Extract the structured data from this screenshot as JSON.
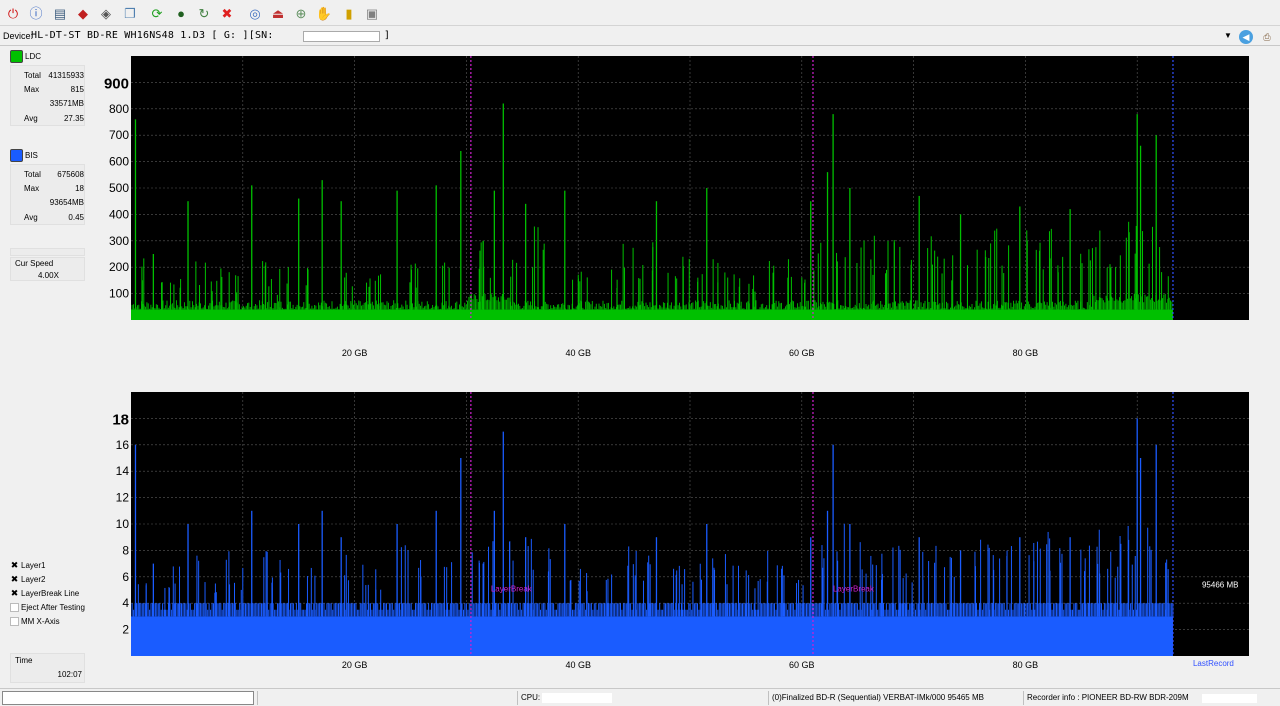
{
  "toolbar": {
    "icons": [
      "power-icon",
      "disc-info-icon",
      "drive-icon",
      "erase-icon",
      "burn-icon",
      "copy-icon",
      "refresh-icon",
      "start-test-icon",
      "rescan-icon",
      "stop-icon",
      "disc-icon",
      "eject-icon",
      "write-icon",
      "settings-icon",
      "chart-icon",
      "save-icon"
    ]
  },
  "device": {
    "label": "Device:",
    "name": "HL-DT-ST BD-RE  WH16NS48  1.D3 [ G: ][SN:",
    "sn_close": "]"
  },
  "sidebar": {
    "ldc": {
      "label": "LDC",
      "color": "#00c000",
      "total_label": "Total",
      "total": "41315933",
      "max_label": "Max",
      "max": "815",
      "max_pos": "33571MB",
      "avg_label": "Avg",
      "avg": "27.35"
    },
    "bis": {
      "label": "BIS",
      "color": "#1a5cff",
      "total_label": "Total",
      "total": "675608",
      "max_label": "Max",
      "max": "18",
      "max_pos": "93654MB",
      "avg_label": "Avg",
      "avg": "0.45"
    },
    "cur_speed_label": "Cur Speed",
    "cur_speed": "4.00X",
    "options": [
      {
        "label": "Layer1",
        "checked": true
      },
      {
        "label": "Layer2",
        "checked": true
      },
      {
        "label": "LayerBreak Line",
        "checked": true
      },
      {
        "label": "Eject After Testing",
        "checked": false
      },
      {
        "label": "MM X-Axis",
        "checked": false
      }
    ],
    "time_label": "Time",
    "time": "102:07"
  },
  "chart_data": [
    {
      "type": "area",
      "title": "",
      "series": [
        {
          "name": "LDC",
          "color": "#00c000"
        }
      ],
      "x_ticks": [
        "20 GB",
        "40 GB",
        "60 GB",
        "80 GB"
      ],
      "x_tick_values": [
        20,
        40,
        60,
        80
      ],
      "xlim": [
        0,
        100
      ],
      "y_ticks": [
        100,
        200,
        300,
        400,
        500,
        600,
        700,
        800,
        900
      ],
      "ylim": [
        0,
        1000
      ],
      "y_max_label": "900",
      "baseline": 40,
      "data_end_gb": 93.2,
      "layerbreaks_gb": [
        30.4,
        61.0
      ],
      "end_marker_gb": 93.2,
      "spikes": [
        [
          0.4,
          760
        ],
        [
          2.0,
          250
        ],
        [
          5.1,
          450
        ],
        [
          10.8,
          510
        ],
        [
          15.0,
          460
        ],
        [
          17.1,
          530
        ],
        [
          18.8,
          450
        ],
        [
          23.8,
          490
        ],
        [
          27.3,
          510
        ],
        [
          29.5,
          640
        ],
        [
          31.5,
          300
        ],
        [
          32.5,
          490
        ],
        [
          33.3,
          820
        ],
        [
          35.3,
          440
        ],
        [
          38.8,
          490
        ],
        [
          47.0,
          450
        ],
        [
          51.5,
          500
        ],
        [
          60.8,
          450
        ],
        [
          62.3,
          560
        ],
        [
          62.8,
          780
        ],
        [
          64.3,
          500
        ],
        [
          70.5,
          470
        ],
        [
          74.2,
          400
        ],
        [
          79.5,
          430
        ],
        [
          84.0,
          420
        ],
        [
          90.0,
          780
        ],
        [
          90.3,
          660
        ],
        [
          91.7,
          700
        ]
      ],
      "grass": [
        [
          1.0,
          240
        ],
        [
          3.2,
          170
        ],
        [
          4.2,
          200
        ],
        [
          6.2,
          230
        ],
        [
          7.3,
          160
        ],
        [
          8.4,
          220
        ],
        [
          9.6,
          180
        ],
        [
          11.7,
          230
        ],
        [
          12.6,
          160
        ],
        [
          13.8,
          240
        ],
        [
          16.1,
          200
        ],
        [
          19.6,
          230
        ],
        [
          20.9,
          220
        ],
        [
          22.1,
          180
        ],
        [
          24.6,
          260
        ],
        [
          25.9,
          220
        ],
        [
          28.2,
          230
        ],
        [
          30.9,
          300
        ],
        [
          31.9,
          250
        ],
        [
          34.1,
          290
        ],
        [
          36.0,
          390
        ],
        [
          37.3,
          360
        ],
        [
          39.7,
          240
        ],
        [
          40.5,
          200
        ],
        [
          43.0,
          200
        ],
        [
          44.5,
          310
        ],
        [
          45.4,
          240
        ],
        [
          46.4,
          330
        ],
        [
          48.4,
          250
        ],
        [
          49.5,
          260
        ],
        [
          50.7,
          270
        ],
        [
          52.4,
          250
        ],
        [
          53.6,
          260
        ],
        [
          54.8,
          200
        ],
        [
          56.0,
          180
        ],
        [
          57.4,
          230
        ],
        [
          58.6,
          250
        ],
        [
          59.8,
          200
        ],
        [
          61.5,
          330
        ],
        [
          63.5,
          420
        ],
        [
          65.3,
          360
        ],
        [
          66.2,
          330
        ],
        [
          67.5,
          310
        ],
        [
          68.3,
          340
        ],
        [
          69.5,
          290
        ],
        [
          71.3,
          330
        ],
        [
          72.3,
          290
        ],
        [
          73.2,
          280
        ],
        [
          75.2,
          320
        ],
        [
          76.3,
          300
        ],
        [
          77.2,
          350
        ],
        [
          78.3,
          310
        ],
        [
          80.6,
          370
        ],
        [
          81.5,
          330
        ],
        [
          82.5,
          360
        ],
        [
          83.4,
          340
        ],
        [
          85.2,
          350
        ],
        [
          86.2,
          330
        ],
        [
          87.1,
          360
        ],
        [
          88.0,
          330
        ],
        [
          88.8,
          380
        ],
        [
          89.5,
          420
        ],
        [
          90.9,
          380
        ],
        [
          92.5,
          300
        ]
      ]
    },
    {
      "type": "area",
      "title": "",
      "series": [
        {
          "name": "BIS",
          "color": "#1a5cff"
        }
      ],
      "x_ticks": [
        "20 GB",
        "40 GB",
        "60 GB",
        "80 GB"
      ],
      "x_tick_values": [
        20,
        40,
        60,
        80
      ],
      "xlim": [
        0,
        100
      ],
      "y_ticks": [
        2,
        4,
        6,
        8,
        10,
        12,
        14,
        16,
        18
      ],
      "ylim": [
        0,
        20
      ],
      "y_max_label": "18",
      "baseline": 3,
      "band_top": 4,
      "data_end_gb": 93.2,
      "layerbreaks_gb": [
        30.4,
        61.0
      ],
      "end_marker_gb": 93.2,
      "spikes": [
        [
          0.4,
          16
        ],
        [
          2.0,
          7
        ],
        [
          5.1,
          10
        ],
        [
          10.8,
          11
        ],
        [
          15.0,
          10
        ],
        [
          17.1,
          11
        ],
        [
          18.8,
          9
        ],
        [
          23.8,
          10
        ],
        [
          27.3,
          11
        ],
        [
          29.5,
          15
        ],
        [
          31.5,
          7
        ],
        [
          32.5,
          11
        ],
        [
          33.3,
          17
        ],
        [
          35.3,
          9
        ],
        [
          38.8,
          10
        ],
        [
          47.0,
          9
        ],
        [
          51.5,
          10
        ],
        [
          60.8,
          9
        ],
        [
          62.3,
          11
        ],
        [
          62.8,
          16
        ],
        [
          64.3,
          10
        ],
        [
          70.5,
          9
        ],
        [
          74.2,
          8
        ],
        [
          79.5,
          9
        ],
        [
          84.0,
          9
        ],
        [
          90.0,
          18
        ],
        [
          90.3,
          15
        ],
        [
          91.7,
          16
        ]
      ],
      "grass": [
        [
          1.0,
          7
        ],
        [
          3.2,
          6
        ],
        [
          4.2,
          7
        ],
        [
          6.2,
          8
        ],
        [
          7.3,
          6
        ],
        [
          8.4,
          8
        ],
        [
          9.6,
          7
        ],
        [
          11.7,
          8
        ],
        [
          12.6,
          6
        ],
        [
          13.8,
          8
        ],
        [
          16.1,
          7
        ],
        [
          19.6,
          8
        ],
        [
          20.9,
          8
        ],
        [
          22.1,
          7
        ],
        [
          24.6,
          9
        ],
        [
          25.9,
          8
        ],
        [
          28.2,
          8
        ],
        [
          30.9,
          10
        ],
        [
          31.9,
          9
        ],
        [
          34.1,
          9
        ],
        [
          36.0,
          10
        ],
        [
          37.3,
          9
        ],
        [
          39.7,
          8
        ],
        [
          40.5,
          7
        ],
        [
          43.0,
          7
        ],
        [
          44.5,
          9
        ],
        [
          45.4,
          8
        ],
        [
          46.4,
          9
        ],
        [
          48.4,
          8
        ],
        [
          49.5,
          8
        ],
        [
          50.7,
          8
        ],
        [
          52.4,
          8
        ],
        [
          53.6,
          8
        ],
        [
          54.8,
          7
        ],
        [
          56.0,
          7
        ],
        [
          57.4,
          8
        ],
        [
          58.6,
          8
        ],
        [
          59.8,
          7
        ],
        [
          61.5,
          9
        ],
        [
          63.5,
          11
        ],
        [
          65.3,
          10
        ],
        [
          66.2,
          9
        ],
        [
          67.5,
          9
        ],
        [
          68.3,
          9
        ],
        [
          69.5,
          8
        ],
        [
          71.3,
          9
        ],
        [
          72.3,
          9
        ],
        [
          73.2,
          8
        ],
        [
          75.2,
          9
        ],
        [
          76.3,
          9
        ],
        [
          77.2,
          10
        ],
        [
          78.3,
          9
        ],
        [
          80.6,
          10
        ],
        [
          81.5,
          9
        ],
        [
          82.5,
          10
        ],
        [
          83.4,
          9
        ],
        [
          85.2,
          10
        ],
        [
          86.2,
          9
        ],
        [
          87.1,
          10
        ],
        [
          88.0,
          9
        ],
        [
          88.8,
          10
        ],
        [
          89.5,
          11
        ],
        [
          90.9,
          10
        ],
        [
          92.5,
          8
        ]
      ],
      "annotations": {
        "layerbreak_label": "LayerBreak",
        "end_value": "95466 MB",
        "last_record_label": "LastRecord"
      }
    }
  ],
  "statusbar": {
    "cpu_label": "CPU:",
    "disc_info": "(0)Finalized  BD-R (Sequential)  VERBAT-IMk/000  95465 MB",
    "recorder_info": "Recorder info : PIONEER      BD-RW   BDR-209M"
  }
}
